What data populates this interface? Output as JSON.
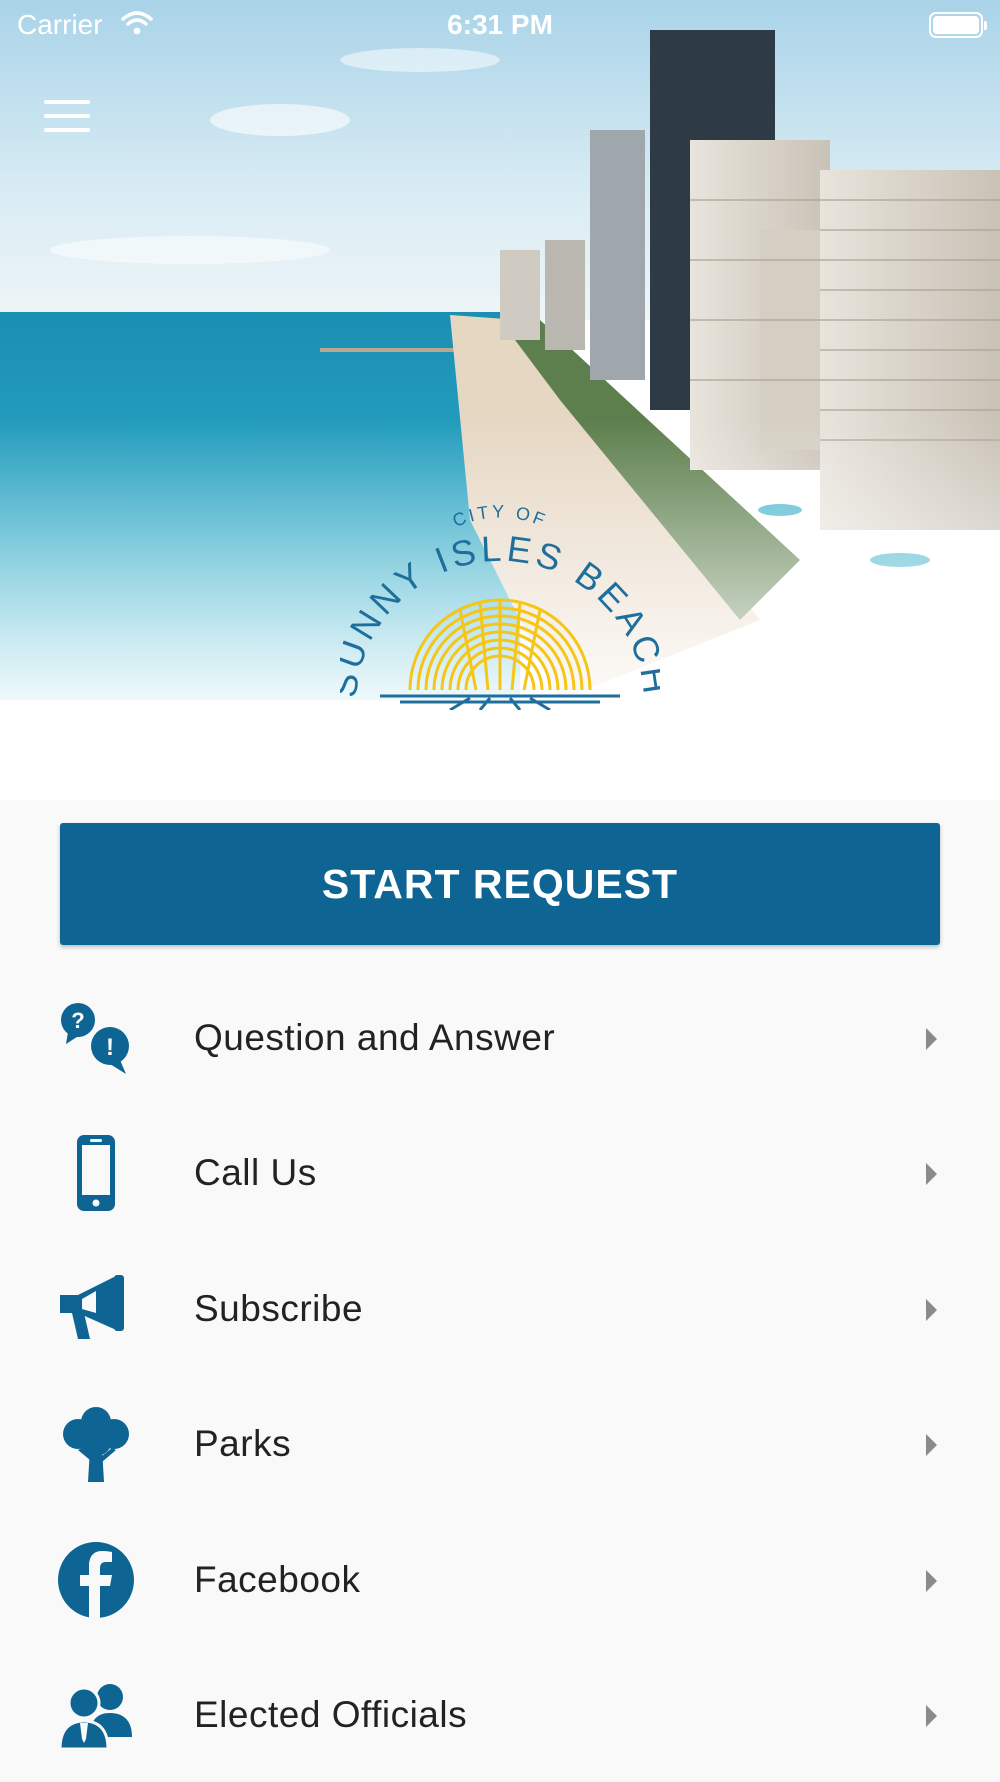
{
  "status_bar": {
    "carrier": "Carrier",
    "time": "6:31 PM",
    "wifi_icon": "wifi-icon",
    "battery_icon": "battery-icon"
  },
  "header": {
    "menu_icon": "hamburger-menu-icon"
  },
  "logo": {
    "line1": "CITY OF",
    "line2": "SUNNY ISLES BEACH",
    "colors": {
      "text": "#1f6f9c",
      "sun": "#f5c518"
    }
  },
  "start_request": {
    "label": "START REQUEST",
    "color": "#0e6593"
  },
  "menu": [
    {
      "label": "Question and Answer",
      "icon": "question-answer-icon"
    },
    {
      "label": "Call Us",
      "icon": "mobile-phone-icon"
    },
    {
      "label": "Subscribe",
      "icon": "megaphone-icon"
    },
    {
      "label": "Parks",
      "icon": "tree-icon"
    },
    {
      "label": "Facebook",
      "icon": "facebook-icon"
    },
    {
      "label": "Elected Officials",
      "icon": "officials-icon"
    }
  ],
  "colors": {
    "icon": "#0e6593",
    "list_background": "#f9f9f9",
    "chevron": "#8a8a8a"
  }
}
